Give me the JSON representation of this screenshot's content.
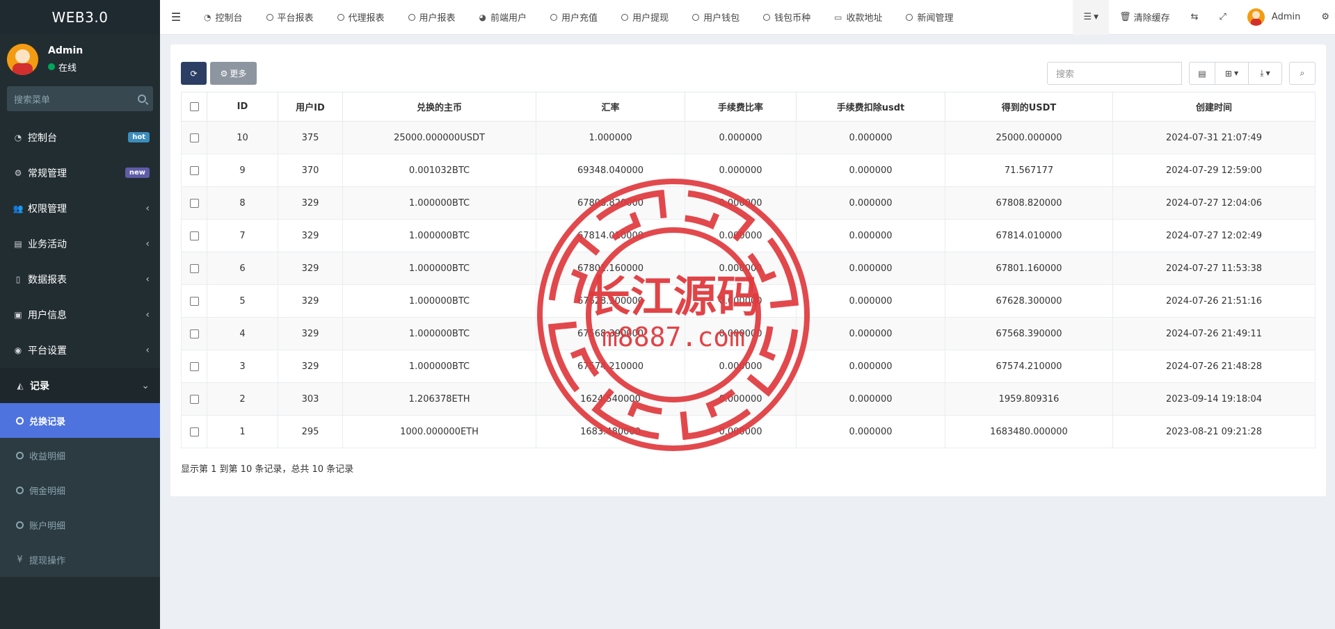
{
  "brand": "WEB3.0",
  "user": {
    "name": "Admin",
    "status": "在线"
  },
  "sidebar": {
    "search_placeholder": "搜索菜单",
    "items": [
      {
        "label": "控制台",
        "icon": "dashboard-icon",
        "badge": "hot"
      },
      {
        "label": "常规管理",
        "icon": "cogs-icon",
        "badge": "new"
      },
      {
        "label": "权限管理",
        "icon": "users-icon"
      },
      {
        "label": "业务活动",
        "icon": "id-card-icon"
      },
      {
        "label": "数据报表",
        "icon": "file-icon"
      },
      {
        "label": "用户信息",
        "icon": "address-book-icon"
      },
      {
        "label": "平台设置",
        "icon": "dot-circle-icon"
      },
      {
        "label": "记录",
        "icon": "area-chart-icon"
      }
    ],
    "sub_items": [
      {
        "label": "兑换记录",
        "active": true
      },
      {
        "label": "收益明细"
      },
      {
        "label": "佣金明细"
      },
      {
        "label": "账户明细"
      },
      {
        "label": "提现操作",
        "icon": "yen"
      }
    ]
  },
  "topnav": {
    "tabs": [
      {
        "label": "控制台",
        "icon": "dashboard-icon"
      },
      {
        "label": "平台报表"
      },
      {
        "label": "代理报表"
      },
      {
        "label": "用户报表"
      },
      {
        "label": "前端用户",
        "icon": "user-circle-icon"
      },
      {
        "label": "用户充值"
      },
      {
        "label": "用户提现"
      },
      {
        "label": "用户钱包"
      },
      {
        "label": "钱包币种"
      },
      {
        "label": "收款地址",
        "icon": "address-card-icon"
      },
      {
        "label": "新闻管理"
      }
    ],
    "clear_cache": "清除缓存",
    "admin": "Admin"
  },
  "toolbar": {
    "more": "更多",
    "search_placeholder": "搜索"
  },
  "table": {
    "columns": [
      "ID",
      "用户ID",
      "兑换的主币",
      "汇率",
      "手续费比率",
      "手续费扣除usdt",
      "得到的USDT",
      "创建时间"
    ],
    "rows": [
      [
        "10",
        "375",
        "25000.000000USDT",
        "1.000000",
        "0.000000",
        "0.000000",
        "25000.000000",
        "2024-07-31 21:07:49"
      ],
      [
        "9",
        "370",
        "0.001032BTC",
        "69348.040000",
        "0.000000",
        "0.000000",
        "71.567177",
        "2024-07-29 12:59:00"
      ],
      [
        "8",
        "329",
        "1.000000BTC",
        "67808.820000",
        "0.000000",
        "0.000000",
        "67808.820000",
        "2024-07-27 12:04:06"
      ],
      [
        "7",
        "329",
        "1.000000BTC",
        "67814.010000",
        "0.000000",
        "0.000000",
        "67814.010000",
        "2024-07-27 12:02:49"
      ],
      [
        "6",
        "329",
        "1.000000BTC",
        "67801.160000",
        "0.000000",
        "0.000000",
        "67801.160000",
        "2024-07-27 11:53:38"
      ],
      [
        "5",
        "329",
        "1.000000BTC",
        "67628.300000",
        "0.000000",
        "0.000000",
        "67628.300000",
        "2024-07-26 21:51:16"
      ],
      [
        "4",
        "329",
        "1.000000BTC",
        "67568.390000",
        "0.000000",
        "0.000000",
        "67568.390000",
        "2024-07-26 21:49:11"
      ],
      [
        "3",
        "329",
        "1.000000BTC",
        "67574.210000",
        "0.000000",
        "0.000000",
        "67574.210000",
        "2024-07-26 21:48:28"
      ],
      [
        "2",
        "303",
        "1.206378ETH",
        "1624.540000",
        "0.000000",
        "0.000000",
        "1959.809316",
        "2023-09-14 19:18:04"
      ],
      [
        "1",
        "295",
        "1000.000000ETH",
        "1683.480000",
        "0.000000",
        "0.000000",
        "1683480.000000",
        "2023-08-21 09:21:28"
      ]
    ]
  },
  "pager": "显示第 1 到第 10 条记录，总共 10 条记录",
  "watermark": {
    "title": "长江源码",
    "url": "m8887.com",
    "color": "#e03a3e"
  }
}
